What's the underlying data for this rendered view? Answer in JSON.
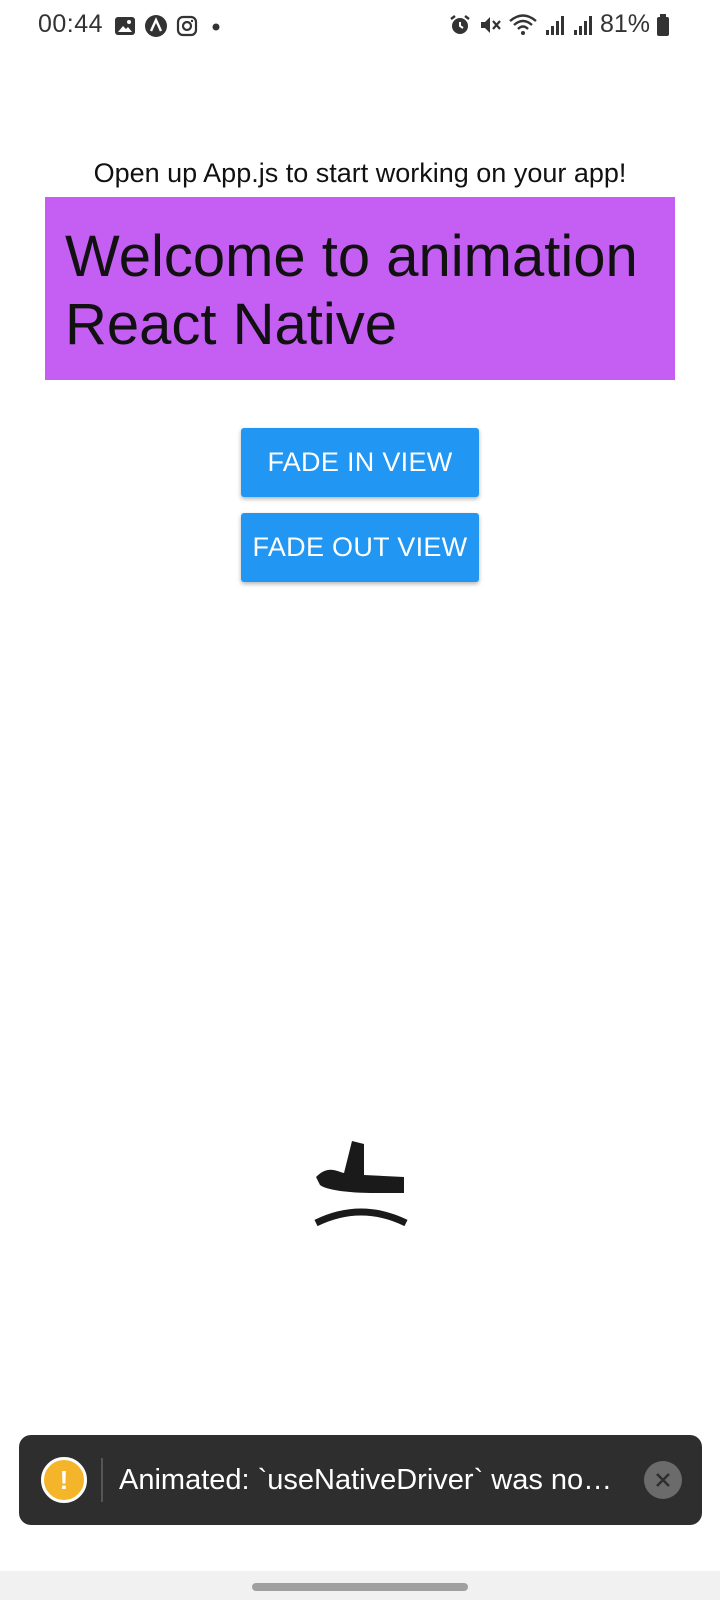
{
  "status_bar": {
    "time": "00:44",
    "battery": "81%",
    "icons": [
      "image-icon",
      "app-a-icon",
      "instagram-icon",
      "dot-icon",
      "alarm-icon",
      "mute-icon",
      "wifi-icon",
      "signal-icon",
      "signal-icon",
      "battery-icon"
    ]
  },
  "main": {
    "hint": "Open up App.js to start working on your app!",
    "banner_line1": "Welcome to animation",
    "banner_line2": "React Native",
    "banner_color": "#c55ef3",
    "fade_in_label": "FADE IN VIEW",
    "fade_out_label": "FADE OUT VIEW",
    "button_color": "#2196f3",
    "animated_icon": "flight-land-icon"
  },
  "toast": {
    "message": "Animated: `useNativeDriver` was not s…",
    "warn_symbol": "!",
    "close_icon": "close-icon"
  }
}
